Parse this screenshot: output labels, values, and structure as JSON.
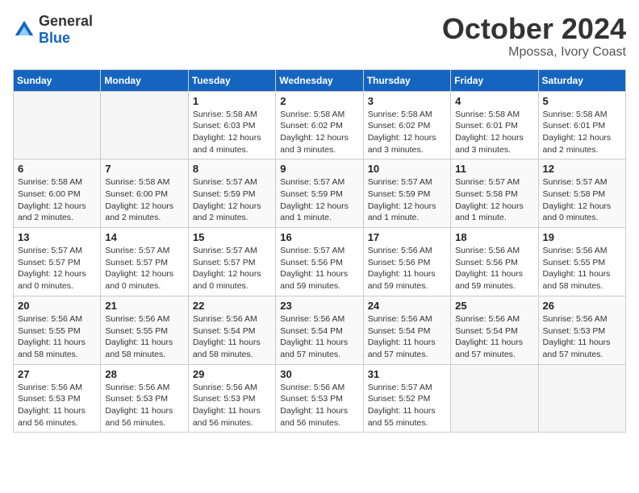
{
  "header": {
    "logo_general": "General",
    "logo_blue": "Blue",
    "month": "October 2024",
    "location": "Mpossa, Ivory Coast"
  },
  "weekdays": [
    "Sunday",
    "Monday",
    "Tuesday",
    "Wednesday",
    "Thursday",
    "Friday",
    "Saturday"
  ],
  "weeks": [
    [
      {
        "day": "",
        "info": ""
      },
      {
        "day": "",
        "info": ""
      },
      {
        "day": "1",
        "info": "Sunrise: 5:58 AM\nSunset: 6:03 PM\nDaylight: 12 hours and 4 minutes."
      },
      {
        "day": "2",
        "info": "Sunrise: 5:58 AM\nSunset: 6:02 PM\nDaylight: 12 hours and 3 minutes."
      },
      {
        "day": "3",
        "info": "Sunrise: 5:58 AM\nSunset: 6:02 PM\nDaylight: 12 hours and 3 minutes."
      },
      {
        "day": "4",
        "info": "Sunrise: 5:58 AM\nSunset: 6:01 PM\nDaylight: 12 hours and 3 minutes."
      },
      {
        "day": "5",
        "info": "Sunrise: 5:58 AM\nSunset: 6:01 PM\nDaylight: 12 hours and 2 minutes."
      }
    ],
    [
      {
        "day": "6",
        "info": "Sunrise: 5:58 AM\nSunset: 6:00 PM\nDaylight: 12 hours and 2 minutes."
      },
      {
        "day": "7",
        "info": "Sunrise: 5:58 AM\nSunset: 6:00 PM\nDaylight: 12 hours and 2 minutes."
      },
      {
        "day": "8",
        "info": "Sunrise: 5:57 AM\nSunset: 5:59 PM\nDaylight: 12 hours and 2 minutes."
      },
      {
        "day": "9",
        "info": "Sunrise: 5:57 AM\nSunset: 5:59 PM\nDaylight: 12 hours and 1 minute."
      },
      {
        "day": "10",
        "info": "Sunrise: 5:57 AM\nSunset: 5:59 PM\nDaylight: 12 hours and 1 minute."
      },
      {
        "day": "11",
        "info": "Sunrise: 5:57 AM\nSunset: 5:58 PM\nDaylight: 12 hours and 1 minute."
      },
      {
        "day": "12",
        "info": "Sunrise: 5:57 AM\nSunset: 5:58 PM\nDaylight: 12 hours and 0 minutes."
      }
    ],
    [
      {
        "day": "13",
        "info": "Sunrise: 5:57 AM\nSunset: 5:57 PM\nDaylight: 12 hours and 0 minutes."
      },
      {
        "day": "14",
        "info": "Sunrise: 5:57 AM\nSunset: 5:57 PM\nDaylight: 12 hours and 0 minutes."
      },
      {
        "day": "15",
        "info": "Sunrise: 5:57 AM\nSunset: 5:57 PM\nDaylight: 12 hours and 0 minutes."
      },
      {
        "day": "16",
        "info": "Sunrise: 5:57 AM\nSunset: 5:56 PM\nDaylight: 11 hours and 59 minutes."
      },
      {
        "day": "17",
        "info": "Sunrise: 5:56 AM\nSunset: 5:56 PM\nDaylight: 11 hours and 59 minutes."
      },
      {
        "day": "18",
        "info": "Sunrise: 5:56 AM\nSunset: 5:56 PM\nDaylight: 11 hours and 59 minutes."
      },
      {
        "day": "19",
        "info": "Sunrise: 5:56 AM\nSunset: 5:55 PM\nDaylight: 11 hours and 58 minutes."
      }
    ],
    [
      {
        "day": "20",
        "info": "Sunrise: 5:56 AM\nSunset: 5:55 PM\nDaylight: 11 hours and 58 minutes."
      },
      {
        "day": "21",
        "info": "Sunrise: 5:56 AM\nSunset: 5:55 PM\nDaylight: 11 hours and 58 minutes."
      },
      {
        "day": "22",
        "info": "Sunrise: 5:56 AM\nSunset: 5:54 PM\nDaylight: 11 hours and 58 minutes."
      },
      {
        "day": "23",
        "info": "Sunrise: 5:56 AM\nSunset: 5:54 PM\nDaylight: 11 hours and 57 minutes."
      },
      {
        "day": "24",
        "info": "Sunrise: 5:56 AM\nSunset: 5:54 PM\nDaylight: 11 hours and 57 minutes."
      },
      {
        "day": "25",
        "info": "Sunrise: 5:56 AM\nSunset: 5:54 PM\nDaylight: 11 hours and 57 minutes."
      },
      {
        "day": "26",
        "info": "Sunrise: 5:56 AM\nSunset: 5:53 PM\nDaylight: 11 hours and 57 minutes."
      }
    ],
    [
      {
        "day": "27",
        "info": "Sunrise: 5:56 AM\nSunset: 5:53 PM\nDaylight: 11 hours and 56 minutes."
      },
      {
        "day": "28",
        "info": "Sunrise: 5:56 AM\nSunset: 5:53 PM\nDaylight: 11 hours and 56 minutes."
      },
      {
        "day": "29",
        "info": "Sunrise: 5:56 AM\nSunset: 5:53 PM\nDaylight: 11 hours and 56 minutes."
      },
      {
        "day": "30",
        "info": "Sunrise: 5:56 AM\nSunset: 5:53 PM\nDaylight: 11 hours and 56 minutes."
      },
      {
        "day": "31",
        "info": "Sunrise: 5:57 AM\nSunset: 5:52 PM\nDaylight: 11 hours and 55 minutes."
      },
      {
        "day": "",
        "info": ""
      },
      {
        "day": "",
        "info": ""
      }
    ]
  ]
}
